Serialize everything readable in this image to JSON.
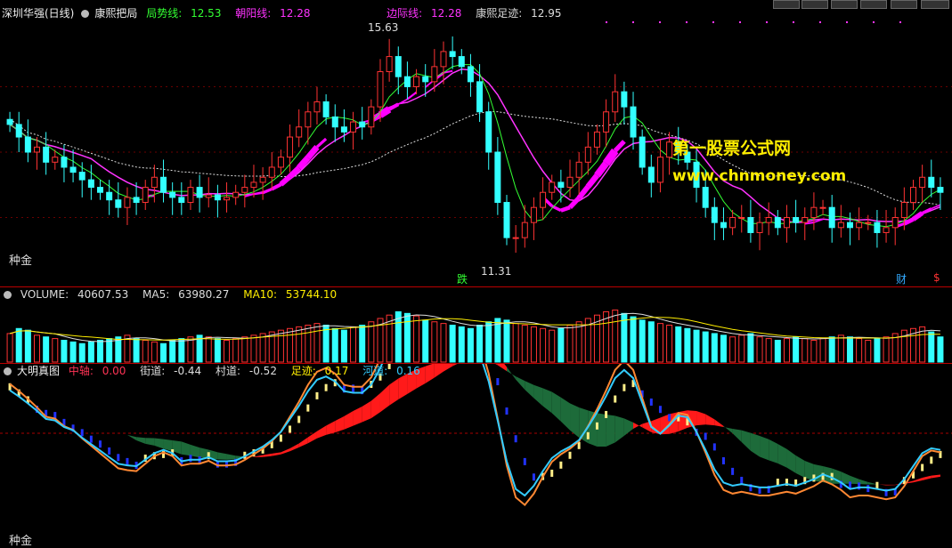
{
  "main": {
    "title": "深圳华强(日线)",
    "indicator_name": "康熙把局",
    "items": [
      {
        "label": "局势线:",
        "value": "12.53",
        "color": "#33ff33"
      },
      {
        "label": "朝阳线:",
        "value": "12.28",
        "color": "#ff33ff"
      },
      {
        "label": "边际线:",
        "value": "12.28",
        "color": "#ff33ff"
      },
      {
        "label": "康熙足迹:",
        "value": "12.95",
        "color": "#dddddd"
      }
    ],
    "high_label": "15.63",
    "low_label": "11.31",
    "signal_drop": "跌",
    "signal_cai": "财",
    "signal_s": "$",
    "corner_label": "种金",
    "watermark_1": "第一股票公式网",
    "watermark_2": "www.chnmoney.com"
  },
  "volume": {
    "items": [
      {
        "label": "VOLUME:",
        "value": "40607.53",
        "color": "#dddddd"
      },
      {
        "label": "MA5:",
        "value": "63980.27",
        "color": "#dddddd"
      },
      {
        "label": "MA10:",
        "value": "53744.10",
        "color": "#ffee00"
      }
    ]
  },
  "oscillator": {
    "name": "大明真图",
    "items": [
      {
        "label": "中轴:",
        "value": "0.00",
        "color": "#ff3355"
      },
      {
        "label": "街道:",
        "value": "-0.44",
        "color": "#dddddd"
      },
      {
        "label": "村道:",
        "value": "-0.52",
        "color": "#dddddd"
      },
      {
        "label": "足迹:",
        "value": "0.17",
        "color": "#ffee00"
      },
      {
        "label": "河道:",
        "value": "0.16",
        "color": "#33ccff"
      }
    ],
    "corner_label": "种金"
  },
  "chart_data": {
    "type": "candlestick",
    "price_range": [
      10.8,
      16.0
    ],
    "close": [
      13.95,
      13.7,
      13.4,
      13.5,
      13.2,
      13.3,
      13.1,
      13.0,
      12.85,
      12.7,
      12.6,
      12.45,
      12.3,
      12.5,
      12.4,
      12.7,
      12.9,
      12.6,
      12.5,
      12.4,
      12.7,
      12.5,
      12.55,
      12.45,
      12.5,
      12.6,
      12.7,
      12.8,
      12.9,
      13.1,
      13.3,
      13.7,
      13.9,
      14.2,
      14.4,
      14.1,
      13.9,
      13.8,
      14.0,
      13.9,
      14.3,
      15.0,
      15.3,
      14.9,
      14.7,
      14.9,
      14.8,
      15.1,
      15.4,
      15.3,
      15.1,
      14.8,
      14.2,
      13.4,
      12.4,
      11.7,
      11.7,
      12.0,
      12.3,
      12.6,
      12.8,
      12.7,
      12.9,
      13.2,
      13.5,
      13.8,
      14.2,
      14.6,
      14.3,
      13.7,
      13.1,
      12.8,
      13.3,
      13.6,
      13.4,
      13.2,
      12.7,
      12.3,
      12.0,
      11.9,
      12.1,
      12.1,
      11.8,
      12.0,
      12.1,
      11.9,
      12.1,
      12.0,
      12.1,
      12.3,
      12.3,
      11.9,
      12.0,
      11.9,
      12.0,
      12.0,
      11.8,
      11.9,
      12.1,
      12.4,
      12.7,
      12.9,
      12.7,
      12.6
    ],
    "volume": [
      34,
      40,
      38,
      32,
      30,
      28,
      26,
      24,
      22,
      24,
      26,
      28,
      30,
      32,
      28,
      26,
      24,
      22,
      26,
      28,
      30,
      32,
      30,
      28,
      26,
      28,
      30,
      32,
      34,
      36,
      38,
      40,
      42,
      44,
      46,
      44,
      40,
      38,
      42,
      44,
      48,
      52,
      56,
      60,
      58,
      55,
      50,
      48,
      46,
      44,
      42,
      40,
      44,
      48,
      52,
      50,
      46,
      44,
      42,
      40,
      38,
      40,
      44,
      48,
      52,
      56,
      60,
      62,
      58,
      54,
      50,
      48,
      46,
      44,
      42,
      40,
      38,
      36,
      34,
      32,
      30,
      32,
      34,
      30,
      28,
      26,
      28,
      30,
      28,
      26,
      28,
      30,
      32,
      30,
      28,
      26,
      28,
      30,
      34,
      38,
      40,
      42,
      36,
      30
    ],
    "volume_ma5_last": 63980.27,
    "volume_ma10_last": 53744.1,
    "indicator_last": {
      "局势线": 12.53,
      "朝阳线": 12.28,
      "边际线": 12.28,
      "康熙足迹": 12.95
    },
    "oscillator_last": {
      "中轴": 0.0,
      "街道": -0.44,
      "村道": -0.52,
      "足迹": 0.17,
      "河道": 0.16
    }
  }
}
